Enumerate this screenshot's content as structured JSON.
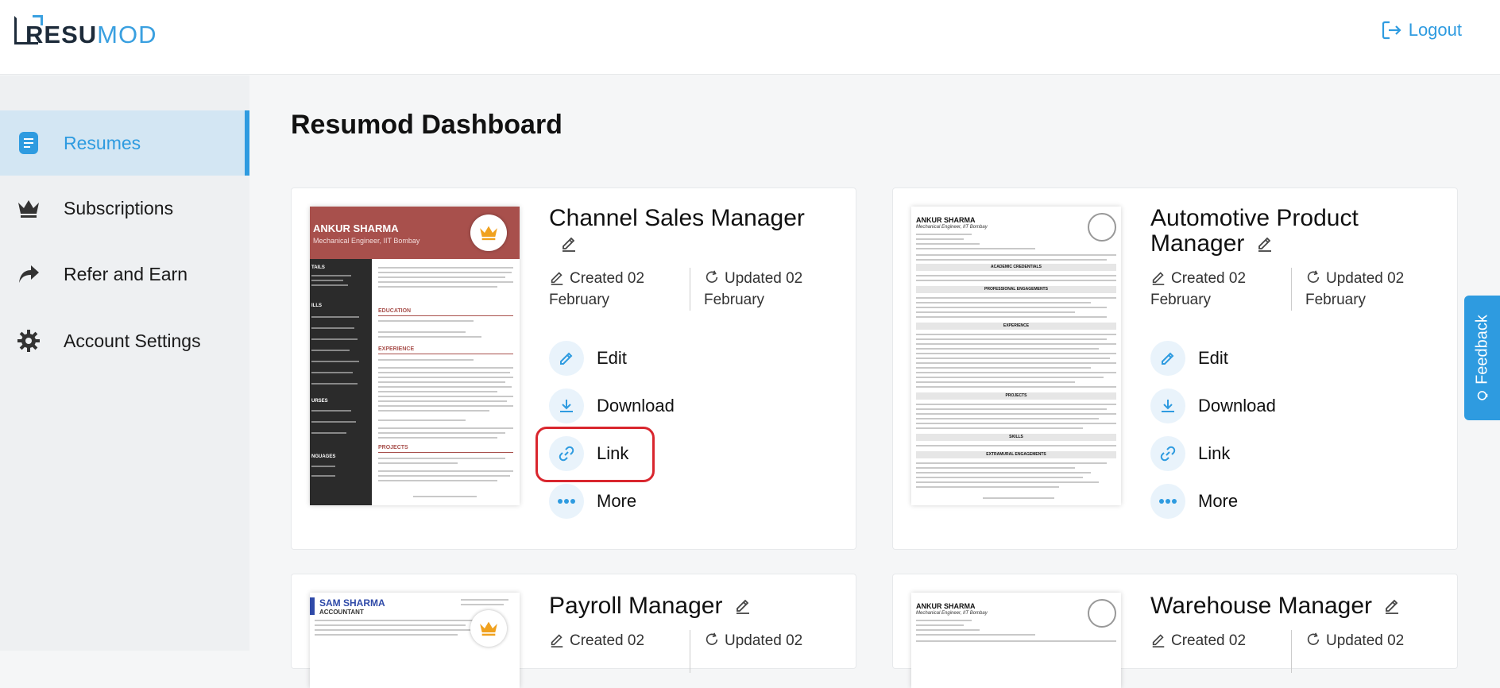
{
  "header": {
    "logo_bold": "RESU",
    "logo_accent": "MOD",
    "logout_label": "Logout"
  },
  "sidebar": {
    "items": [
      {
        "label": "Resumes",
        "icon": "resume-icon",
        "active": true
      },
      {
        "label": "Subscriptions",
        "icon": "crown-icon"
      },
      {
        "label": "Refer and Earn",
        "icon": "share-arrow-icon"
      },
      {
        "label": "Account Settings",
        "icon": "gear-icon"
      }
    ]
  },
  "main": {
    "title": "Resumod Dashboard"
  },
  "cards": [
    {
      "title": "Channel Sales Manager",
      "created_label": "Created 02",
      "created_month": "February",
      "updated_label": "Updated 02",
      "updated_month": "February",
      "thumb_name": "ANKUR SHARMA",
      "thumb_role": "Mechanical Engineer, IIT Bombay",
      "thumb_side": [
        "TAILS",
        "ILLS",
        "URSES",
        "NGUAGES"
      ],
      "thumb_sections": [
        "EDUCATION",
        "EXPERIENCE",
        "PROJECTS"
      ],
      "actions": [
        "Edit",
        "Download",
        "Link",
        "More"
      ],
      "premium": true
    },
    {
      "title_line1": "Automotive Product",
      "title_line2": "Manager",
      "created_label": "Created 02",
      "created_month": "February",
      "updated_label": "Updated 02",
      "updated_month": "February",
      "thumb_name": "ANKUR SHARMA",
      "thumb_role": "Mechanical Engineer, IIT Bombay",
      "thumb_sections": [
        "ACADEMIC CREDENTIALS",
        "PROFESSIONAL ENGAGEMENTS",
        "EXPERIENCE",
        "PROJECTS",
        "SKILLS",
        "EXTRAMURAL ENGAGEMENTS"
      ],
      "actions": [
        "Edit",
        "Download",
        "Link",
        "More"
      ]
    },
    {
      "title": "Payroll Manager",
      "created_label": "Created 02",
      "updated_label": "Updated 02",
      "thumb_name": "SAM SHARMA",
      "thumb_role": "ACCOUNTANT",
      "premium": true
    },
    {
      "title": "Warehouse Manager",
      "created_label": "Created 02",
      "updated_label": "Updated 02",
      "thumb_name": "ANKUR SHARMA",
      "thumb_role": "Mechanical Engineer, IIT Bombay"
    }
  ],
  "feedback_label": "Feedback",
  "colors": {
    "accent": "#2e9be0",
    "highlight": "#d9262e",
    "resume_header": "#a8504c",
    "premium_gold": "#f0a11e"
  }
}
